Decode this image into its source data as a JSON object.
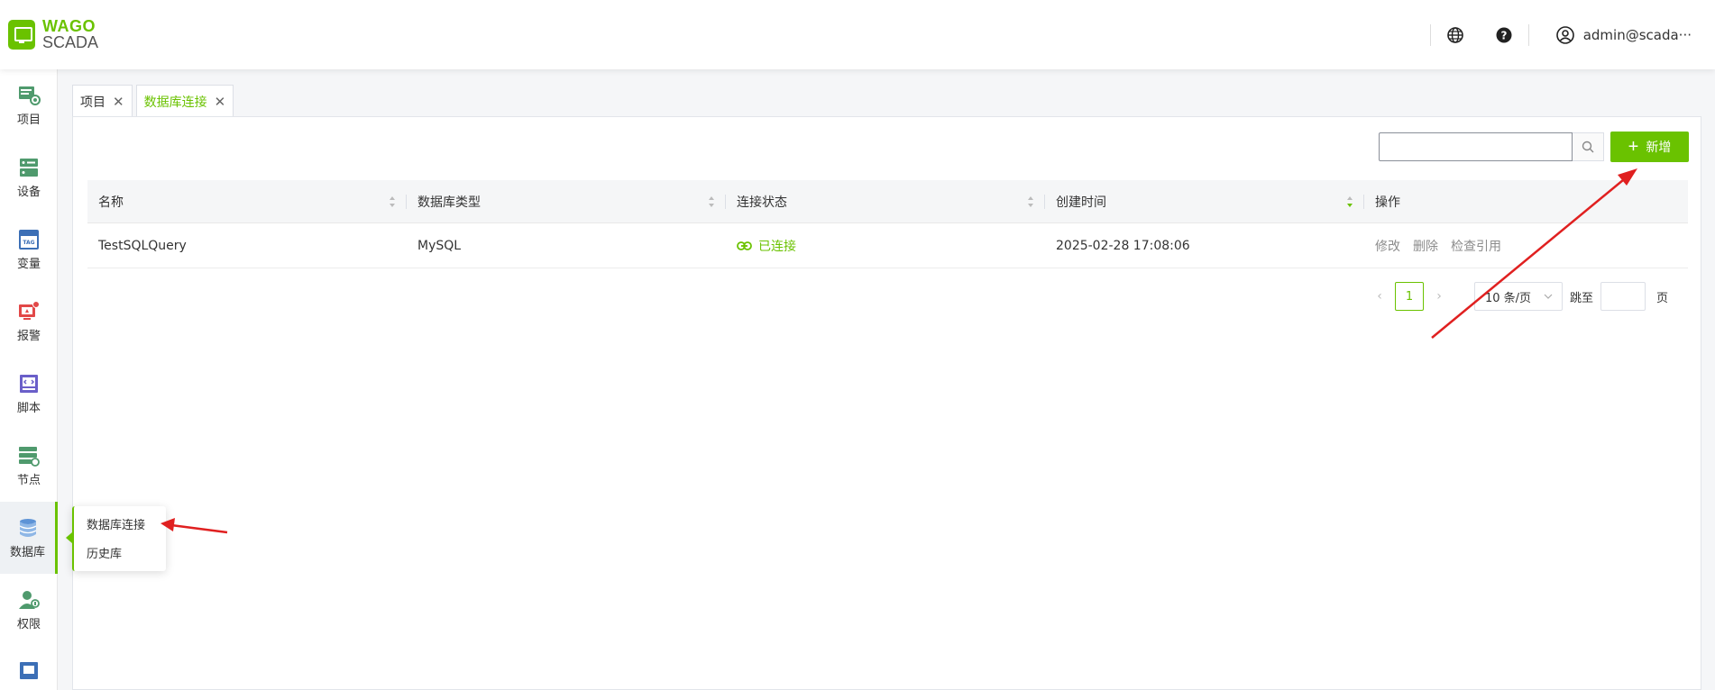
{
  "app": {
    "logo_top": "WAGO",
    "logo_bottom": "SCADA"
  },
  "header": {
    "user": "admin@scada···"
  },
  "sidebar": {
    "items": [
      {
        "label": "项目",
        "icon": "project-icon"
      },
      {
        "label": "设备",
        "icon": "device-icon"
      },
      {
        "label": "变量",
        "icon": "tag-icon"
      },
      {
        "label": "报警",
        "icon": "alarm-icon"
      },
      {
        "label": "脚本",
        "icon": "script-icon"
      },
      {
        "label": "节点",
        "icon": "node-icon"
      },
      {
        "label": "数据库",
        "icon": "database-icon"
      },
      {
        "label": "权限",
        "icon": "permission-icon"
      }
    ]
  },
  "flyout": {
    "items": [
      "数据库连接",
      "历史库"
    ]
  },
  "tabs": [
    {
      "label": "项目"
    },
    {
      "label": "数据库连接"
    }
  ],
  "toolbar": {
    "search_value": "",
    "add_label": "新增"
  },
  "table": {
    "columns": [
      "名称",
      "数据库类型",
      "连接状态",
      "创建时间",
      "操作"
    ],
    "rows": [
      {
        "name": "TestSQLQuery",
        "type": "MySQL",
        "status": "已连接",
        "created": "2025-02-28 17:08:06",
        "actions": [
          "修改",
          "删除",
          "检查引用"
        ]
      }
    ]
  },
  "pagination": {
    "current": "1",
    "page_size": "10 条/页",
    "jump_label": "跳至",
    "page_unit": "页"
  },
  "colors": {
    "accent": "#6ac200",
    "annotation": "#e02020"
  }
}
